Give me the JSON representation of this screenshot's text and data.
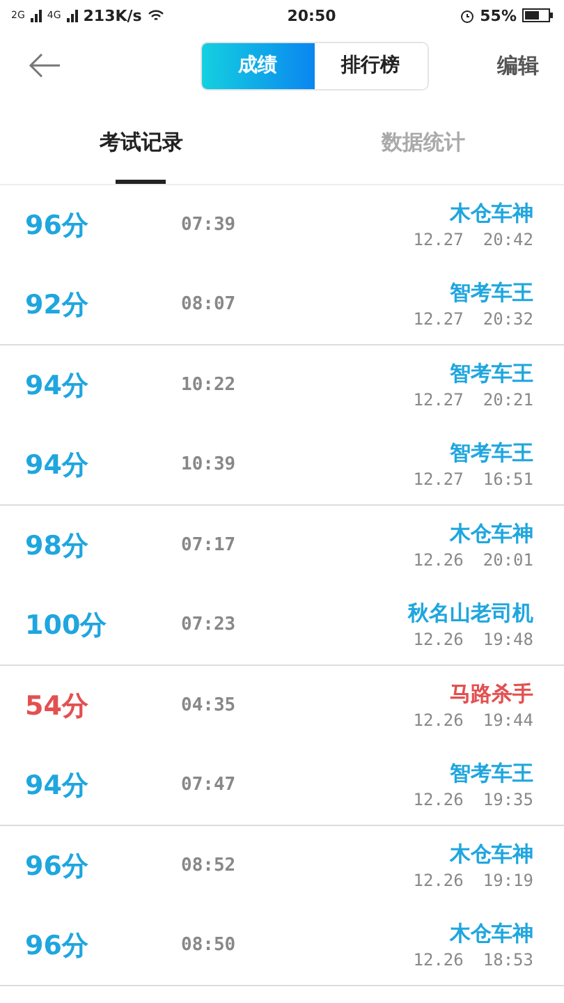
{
  "status_bar": {
    "signal_1": "2G",
    "signal_2": "4G",
    "speed": "213K/s",
    "time": "20:50",
    "battery": "55%"
  },
  "nav": {
    "segments": [
      {
        "label": "成绩",
        "selected": true
      },
      {
        "label": "排行榜",
        "selected": false
      }
    ],
    "action": "编辑"
  },
  "tabs": [
    {
      "label": "考试记录",
      "selected": true
    },
    {
      "label": "数据统计",
      "selected": false
    }
  ],
  "groups": [
    {
      "rows": [
        {
          "score": "96分",
          "duration": "07:39",
          "title": "木仓车神",
          "date": "12.27",
          "time": "20:42",
          "passed": true
        },
        {
          "score": "92分",
          "duration": "08:07",
          "title": "智考车王",
          "date": "12.27",
          "time": "20:32",
          "passed": true
        }
      ]
    },
    {
      "rows": [
        {
          "score": "94分",
          "duration": "10:22",
          "title": "智考车王",
          "date": "12.27",
          "time": "20:21",
          "passed": true
        },
        {
          "score": "94分",
          "duration": "10:39",
          "title": "智考车王",
          "date": "12.27",
          "time": "16:51",
          "passed": true
        }
      ]
    },
    {
      "rows": [
        {
          "score": "98分",
          "duration": "07:17",
          "title": "木仓车神",
          "date": "12.26",
          "time": "20:01",
          "passed": true
        },
        {
          "score": "100分",
          "duration": "07:23",
          "title": "秋名山老司机",
          "date": "12.26",
          "time": "19:48",
          "passed": true
        }
      ]
    },
    {
      "rows": [
        {
          "score": "54分",
          "duration": "04:35",
          "title": "马路杀手",
          "date": "12.26",
          "time": "19:44",
          "passed": false
        },
        {
          "score": "94分",
          "duration": "07:47",
          "title": "智考车王",
          "date": "12.26",
          "time": "19:35",
          "passed": true
        }
      ]
    },
    {
      "rows": [
        {
          "score": "96分",
          "duration": "08:52",
          "title": "木仓车神",
          "date": "12.26",
          "time": "19:19",
          "passed": true
        },
        {
          "score": "96分",
          "duration": "08:50",
          "title": "木仓车神",
          "date": "12.26",
          "time": "18:53",
          "passed": true
        }
      ]
    }
  ]
}
